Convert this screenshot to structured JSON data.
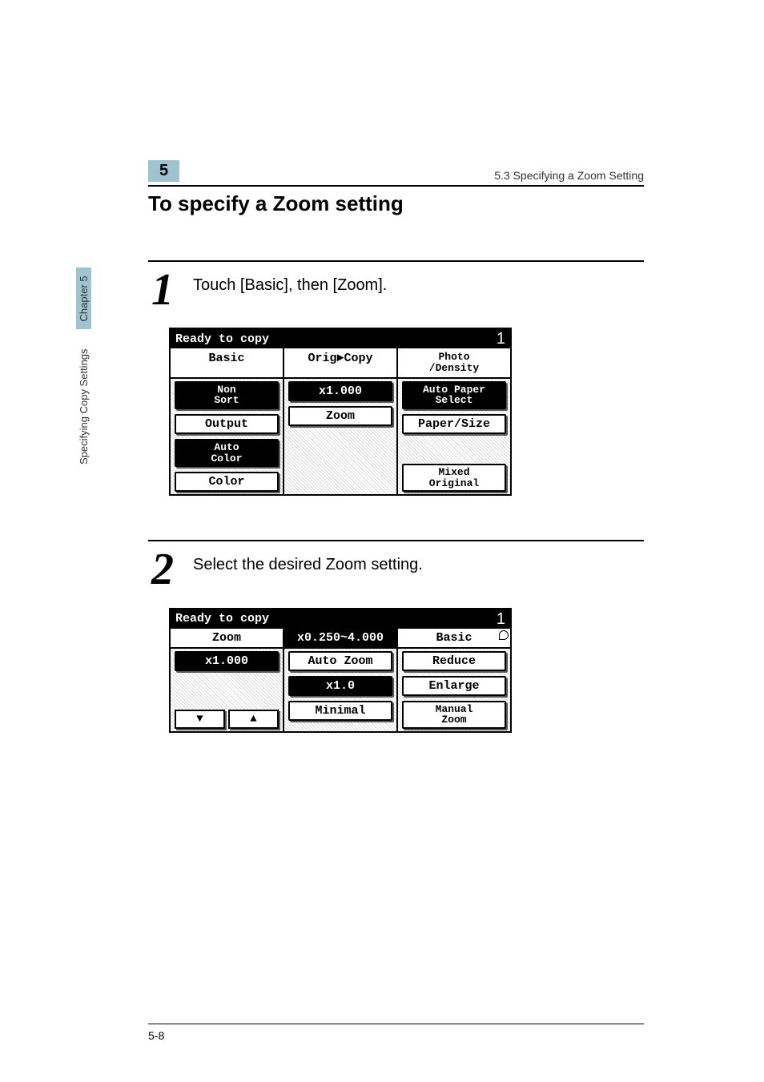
{
  "header": {
    "chapter_num": "5",
    "running_head": "5.3 Specifying a Zoom Setting"
  },
  "section_title": "To specify a Zoom setting",
  "steps": {
    "one": {
      "num": "1",
      "text": "Touch [Basic], then [Zoom]."
    },
    "two": {
      "num": "2",
      "text": "Select the desired Zoom setting."
    }
  },
  "lcd1": {
    "status": "Ready to copy",
    "count": "1",
    "tabs": {
      "basic": "Basic",
      "orig": "Orig►Copy",
      "photo": "Photo\n/Density"
    },
    "col1": {
      "nonsort": "Non\nSort",
      "output": "Output",
      "autocolor": "Auto\nColor",
      "color": "Color"
    },
    "col2": {
      "x1": "x1.000",
      "zoom": "Zoom"
    },
    "col3": {
      "autopaper": "Auto Paper\nSelect",
      "papersize": "Paper/Size",
      "mixed": "Mixed\nOriginal"
    }
  },
  "lcd2": {
    "status": "Ready to copy",
    "count": "1",
    "tabs": {
      "zoom": "Zoom",
      "range": "x0.250~4.000",
      "basic": "Basic"
    },
    "col1": {
      "x1": "x1.000",
      "down": "▼",
      "up": "▲"
    },
    "col2": {
      "autozoom": "Auto Zoom",
      "x1btn": "x1.0",
      "minimal": "Minimal"
    },
    "col3": {
      "reduce": "Reduce",
      "enlarge": "Enlarge",
      "manual": "Manual\nZoom"
    }
  },
  "sidebar": {
    "label": "Specifying Copy Settings",
    "chapter": "Chapter 5"
  },
  "footer": {
    "page": "5-8"
  }
}
